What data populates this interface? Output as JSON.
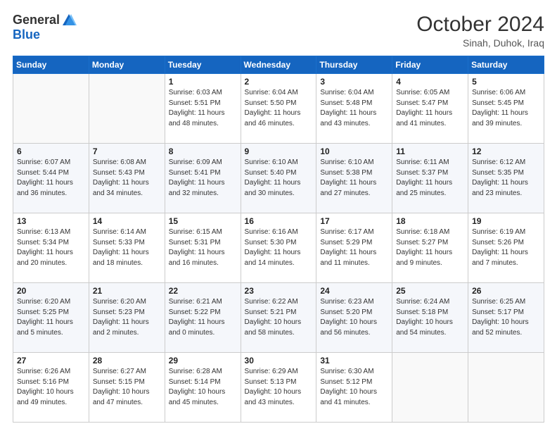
{
  "logo": {
    "general": "General",
    "blue": "Blue"
  },
  "header": {
    "month_year": "October 2024",
    "location": "Sinah, Duhok, Iraq"
  },
  "weekdays": [
    "Sunday",
    "Monday",
    "Tuesday",
    "Wednesday",
    "Thursday",
    "Friday",
    "Saturday"
  ],
  "weeks": [
    [
      {
        "day": "",
        "info": ""
      },
      {
        "day": "",
        "info": ""
      },
      {
        "day": "1",
        "info": "Sunrise: 6:03 AM\nSunset: 5:51 PM\nDaylight: 11 hours and 48 minutes."
      },
      {
        "day": "2",
        "info": "Sunrise: 6:04 AM\nSunset: 5:50 PM\nDaylight: 11 hours and 46 minutes."
      },
      {
        "day": "3",
        "info": "Sunrise: 6:04 AM\nSunset: 5:48 PM\nDaylight: 11 hours and 43 minutes."
      },
      {
        "day": "4",
        "info": "Sunrise: 6:05 AM\nSunset: 5:47 PM\nDaylight: 11 hours and 41 minutes."
      },
      {
        "day": "5",
        "info": "Sunrise: 6:06 AM\nSunset: 5:45 PM\nDaylight: 11 hours and 39 minutes."
      }
    ],
    [
      {
        "day": "6",
        "info": "Sunrise: 6:07 AM\nSunset: 5:44 PM\nDaylight: 11 hours and 36 minutes."
      },
      {
        "day": "7",
        "info": "Sunrise: 6:08 AM\nSunset: 5:43 PM\nDaylight: 11 hours and 34 minutes."
      },
      {
        "day": "8",
        "info": "Sunrise: 6:09 AM\nSunset: 5:41 PM\nDaylight: 11 hours and 32 minutes."
      },
      {
        "day": "9",
        "info": "Sunrise: 6:10 AM\nSunset: 5:40 PM\nDaylight: 11 hours and 30 minutes."
      },
      {
        "day": "10",
        "info": "Sunrise: 6:10 AM\nSunset: 5:38 PM\nDaylight: 11 hours and 27 minutes."
      },
      {
        "day": "11",
        "info": "Sunrise: 6:11 AM\nSunset: 5:37 PM\nDaylight: 11 hours and 25 minutes."
      },
      {
        "day": "12",
        "info": "Sunrise: 6:12 AM\nSunset: 5:35 PM\nDaylight: 11 hours and 23 minutes."
      }
    ],
    [
      {
        "day": "13",
        "info": "Sunrise: 6:13 AM\nSunset: 5:34 PM\nDaylight: 11 hours and 20 minutes."
      },
      {
        "day": "14",
        "info": "Sunrise: 6:14 AM\nSunset: 5:33 PM\nDaylight: 11 hours and 18 minutes."
      },
      {
        "day": "15",
        "info": "Sunrise: 6:15 AM\nSunset: 5:31 PM\nDaylight: 11 hours and 16 minutes."
      },
      {
        "day": "16",
        "info": "Sunrise: 6:16 AM\nSunset: 5:30 PM\nDaylight: 11 hours and 14 minutes."
      },
      {
        "day": "17",
        "info": "Sunrise: 6:17 AM\nSunset: 5:29 PM\nDaylight: 11 hours and 11 minutes."
      },
      {
        "day": "18",
        "info": "Sunrise: 6:18 AM\nSunset: 5:27 PM\nDaylight: 11 hours and 9 minutes."
      },
      {
        "day": "19",
        "info": "Sunrise: 6:19 AM\nSunset: 5:26 PM\nDaylight: 11 hours and 7 minutes."
      }
    ],
    [
      {
        "day": "20",
        "info": "Sunrise: 6:20 AM\nSunset: 5:25 PM\nDaylight: 11 hours and 5 minutes."
      },
      {
        "day": "21",
        "info": "Sunrise: 6:20 AM\nSunset: 5:23 PM\nDaylight: 11 hours and 2 minutes."
      },
      {
        "day": "22",
        "info": "Sunrise: 6:21 AM\nSunset: 5:22 PM\nDaylight: 11 hours and 0 minutes."
      },
      {
        "day": "23",
        "info": "Sunrise: 6:22 AM\nSunset: 5:21 PM\nDaylight: 10 hours and 58 minutes."
      },
      {
        "day": "24",
        "info": "Sunrise: 6:23 AM\nSunset: 5:20 PM\nDaylight: 10 hours and 56 minutes."
      },
      {
        "day": "25",
        "info": "Sunrise: 6:24 AM\nSunset: 5:18 PM\nDaylight: 10 hours and 54 minutes."
      },
      {
        "day": "26",
        "info": "Sunrise: 6:25 AM\nSunset: 5:17 PM\nDaylight: 10 hours and 52 minutes."
      }
    ],
    [
      {
        "day": "27",
        "info": "Sunrise: 6:26 AM\nSunset: 5:16 PM\nDaylight: 10 hours and 49 minutes."
      },
      {
        "day": "28",
        "info": "Sunrise: 6:27 AM\nSunset: 5:15 PM\nDaylight: 10 hours and 47 minutes."
      },
      {
        "day": "29",
        "info": "Sunrise: 6:28 AM\nSunset: 5:14 PM\nDaylight: 10 hours and 45 minutes."
      },
      {
        "day": "30",
        "info": "Sunrise: 6:29 AM\nSunset: 5:13 PM\nDaylight: 10 hours and 43 minutes."
      },
      {
        "day": "31",
        "info": "Sunrise: 6:30 AM\nSunset: 5:12 PM\nDaylight: 10 hours and 41 minutes."
      },
      {
        "day": "",
        "info": ""
      },
      {
        "day": "",
        "info": ""
      }
    ]
  ]
}
